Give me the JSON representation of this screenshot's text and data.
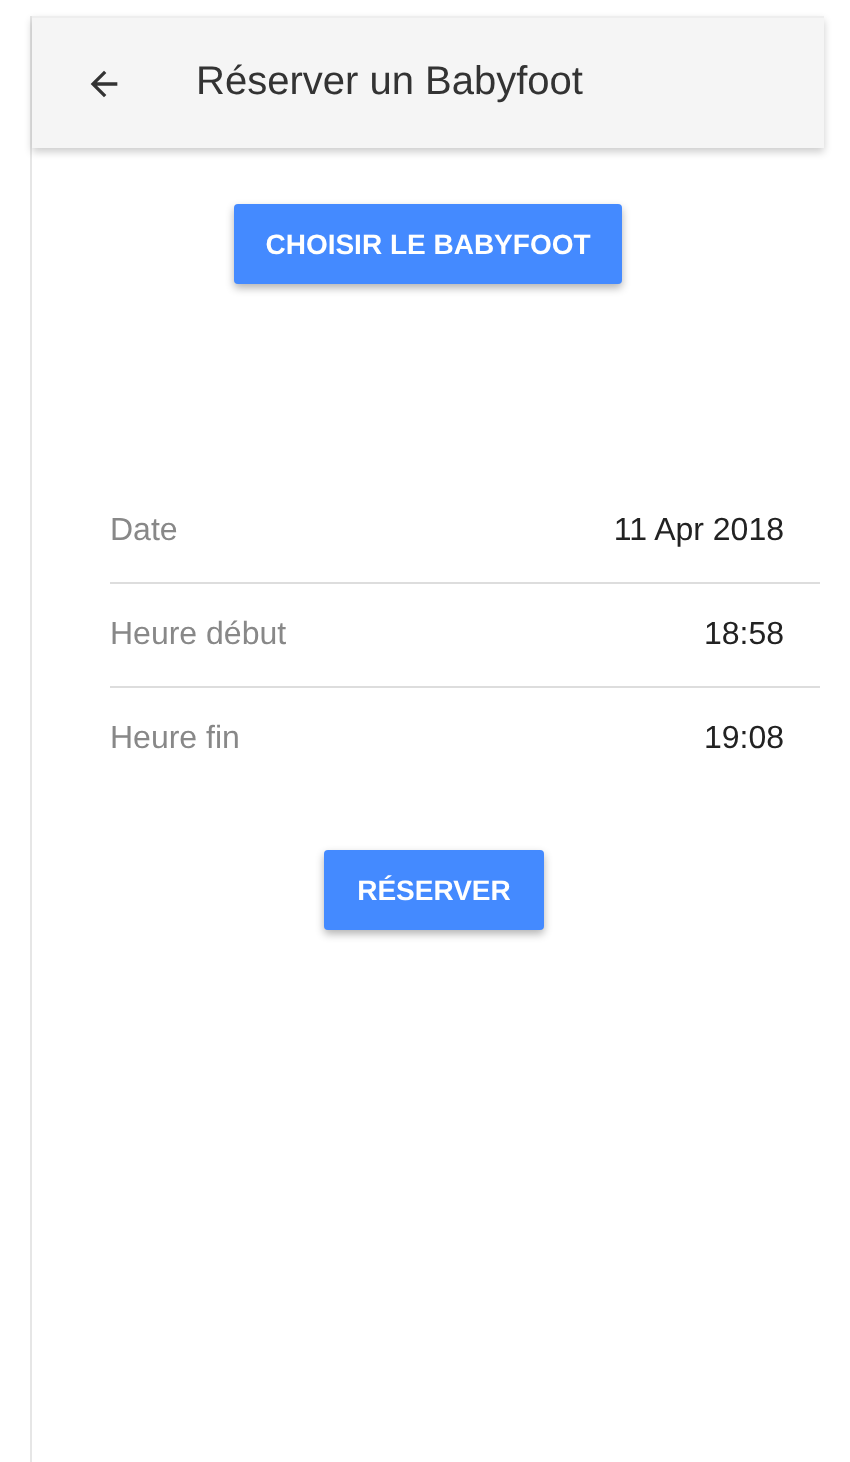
{
  "app_bar": {
    "title": "Réserver un Babyfoot"
  },
  "choose_button": {
    "label": "CHOISIR LE BABYFOOT"
  },
  "details": [
    {
      "label": "Date",
      "value": "11 Apr 2018"
    },
    {
      "label": "Heure début",
      "value": "18:58"
    },
    {
      "label": "Heure fin",
      "value": "19:08"
    }
  ],
  "reserve_button": {
    "label": "RÉSERVER"
  }
}
